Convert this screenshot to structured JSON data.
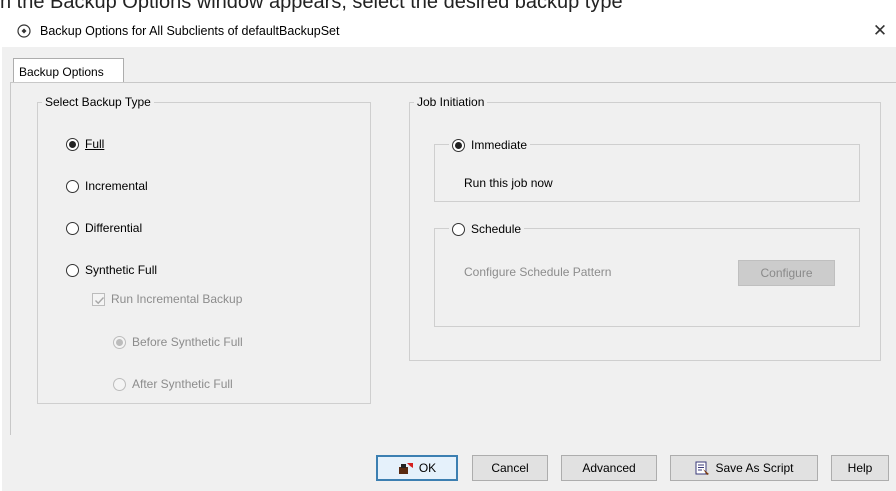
{
  "window": {
    "top_strip_text": "n the Backup Options window appears, select the desired backup type",
    "title": "Backup Options for All Subclients of defaultBackupSet",
    "close_glyph": "✕"
  },
  "tabs": [
    {
      "label": "Backup Options",
      "active": true
    }
  ],
  "backup_type": {
    "group_label": "Select Backup Type",
    "options": [
      {
        "label": "Full",
        "selected": true,
        "enabled": true
      },
      {
        "label": "Incremental",
        "selected": false,
        "enabled": true
      },
      {
        "label": "Differential",
        "selected": false,
        "enabled": true
      },
      {
        "label": "Synthetic Full",
        "selected": false,
        "enabled": true
      }
    ],
    "run_incremental": {
      "label": "Run Incremental Backup",
      "checked": true,
      "enabled": false
    },
    "incremental_timing": [
      {
        "label": "Before Synthetic Full",
        "selected": true,
        "enabled": false
      },
      {
        "label": "After Synthetic Full",
        "selected": false,
        "enabled": false
      }
    ]
  },
  "job_initiation": {
    "group_label": "Job Initiation",
    "immediate": {
      "label": "Immediate",
      "selected": true,
      "description": "Run this job now"
    },
    "schedule": {
      "label": "Schedule",
      "selected": false,
      "pattern_label": "Configure Schedule Pattern",
      "configure_button": "Configure"
    }
  },
  "footer": {
    "ok": "OK",
    "cancel": "Cancel",
    "advanced": "Advanced",
    "save_script": "Save As Script",
    "help": "Help"
  },
  "colors": {
    "dialog_bg": "#f0f0f0",
    "default_button_border": "#3c7fb1",
    "disabled_text": "#8c8c8c"
  }
}
